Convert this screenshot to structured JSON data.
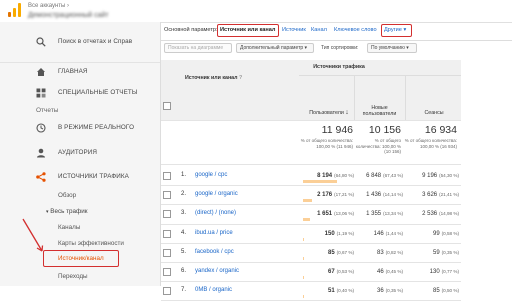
{
  "header": {
    "account_crumb": "Все аккаунты",
    "account_name": "Демонстрационный сайт"
  },
  "sidebar": {
    "search_label": "Поиск в отчетах и Справ",
    "items": [
      {
        "label": "ГЛАВНАЯ"
      },
      {
        "label": "СПЕЦИАЛЬНЫЕ ОТЧЕТЫ"
      }
    ],
    "reports_heading": "Отчеты",
    "report_items": [
      {
        "label": "В РЕЖИМЕ РЕАЛЬНОГО"
      },
      {
        "label": "АУДИТОРИЯ"
      },
      {
        "label": "ИСТОЧНИКИ ТРАФИКА"
      }
    ],
    "sub_items": {
      "overview": "Обзор",
      "all_traffic": "Весь трафик",
      "channels": "Каналы",
      "treemaps": "Карты эффективности",
      "source_medium": "Источник/канал",
      "referrals": "Переходы"
    }
  },
  "tabs": {
    "primary_label": "Основной параметр:",
    "items": [
      "Источник или канал",
      "Источник",
      "Канал",
      "Ключевое слово",
      "Другие"
    ]
  },
  "toolbar": {
    "plot_rows": "Показать на диаграмме",
    "secondary": "Дополнительный параметр",
    "sort_type_label": "Тип сортировки:",
    "sort_value": "По умолчанию"
  },
  "table": {
    "col_dim": "Источник или канал",
    "group_header": "Источники трафика",
    "col_users": "Пользователи",
    "col_new_users": "Новые пользователи",
    "col_sessions": "Сеансы",
    "totals": {
      "users": "11 946",
      "users_sub": "% от общего количества: 100,00 % (11 946)",
      "new_users": "10 156",
      "new_users_sub": "% от общего количества: 100,00 % (10 156)",
      "sessions": "16 934",
      "sessions_sub": "% от общего количества: 100,00 % (16 934)"
    },
    "rows": [
      {
        "n": "1.",
        "source": "google / cpc",
        "users": "8 194",
        "users_pct": "(64,80 %)",
        "new": "6 848",
        "new_pct": "(67,43 %)",
        "sessions": "9 196",
        "sessions_pct": "(54,30 %)",
        "bar": 0.648
      },
      {
        "n": "2.",
        "source": "google / organic",
        "users": "2 176",
        "users_pct": "(17,21 %)",
        "new": "1 436",
        "new_pct": "(14,14 %)",
        "sessions": "3 626",
        "sessions_pct": "(21,41 %)",
        "bar": 0.172
      },
      {
        "n": "3.",
        "source": "(direct) / (none)",
        "users": "1 651",
        "users_pct": "(13,06 %)",
        "new": "1 355",
        "new_pct": "(13,34 %)",
        "sessions": "2 536",
        "sessions_pct": "(14,98 %)",
        "bar": 0.131
      },
      {
        "n": "4.",
        "source": "ibud.ua / price",
        "users": "150",
        "users_pct": "(1,19 %)",
        "new": "146",
        "new_pct": "(1,44 %)",
        "sessions": "99",
        "sessions_pct": "(0,58 %)",
        "bar": 0.012
      },
      {
        "n": "5.",
        "source": "facebook / cpc",
        "users": "85",
        "users_pct": "(0,67 %)",
        "new": "83",
        "new_pct": "(0,82 %)",
        "sessions": "59",
        "sessions_pct": "(0,35 %)",
        "bar": 0.007
      },
      {
        "n": "6.",
        "source": "yandex / organic",
        "users": "67",
        "users_pct": "(0,53 %)",
        "new": "46",
        "new_pct": "(0,45 %)",
        "sessions": "130",
        "sessions_pct": "(0,77 %)",
        "bar": 0.005
      },
      {
        "n": "7.",
        "source": "0MB / organic",
        "users": "51",
        "users_pct": "(0,40 %)",
        "new": "36",
        "new_pct": "(0,35 %)",
        "sessions": "85",
        "sessions_pct": "(0,50 %)",
        "bar": 0.004
      }
    ]
  },
  "colors": {
    "highlight": "#d32f2f",
    "link": "#1a66c8",
    "active_nav": "#e65100",
    "bar": "#fbcf97"
  }
}
